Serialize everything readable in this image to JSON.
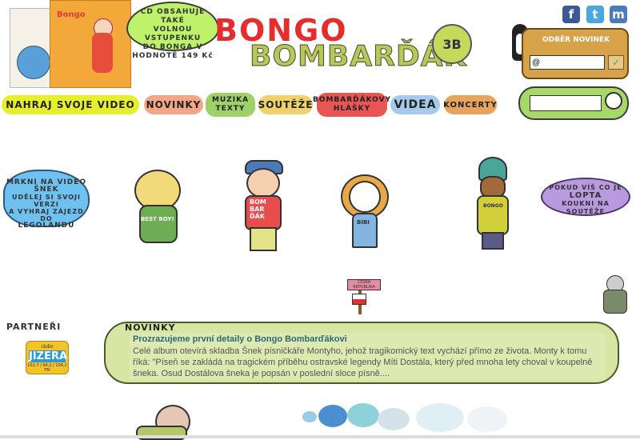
{
  "cd_promo": {
    "cover_label": "Bongo",
    "bubble_lines": [
      "CD OBSAHUJE TAKÉ",
      "VOLNOU VSTUPENKU",
      "DO BONGA V",
      "HODNOTĚ 149 Kč"
    ]
  },
  "logo": {
    "line1": "BONGO",
    "line2": "BOMBARĎÁK",
    "badge": "3B"
  },
  "social": {
    "facebook": "f",
    "twitter": "t",
    "myspace": "m"
  },
  "newsletter": {
    "title": "ODBĚR NOVINEK",
    "input_value": "@",
    "submit_icon": "check-icon"
  },
  "search": {
    "input_value": "",
    "icon": "magnifier-icon"
  },
  "nav": {
    "upload": "NAHRAJ SVOJE VIDEO",
    "news": "NOVINKY",
    "music_1": "MUZIKA",
    "music_2": "TEXTY",
    "contests": "SOUTĚŽE",
    "quotes_1": "BOMBARĎÁKOVY",
    "quotes_2": "HLÁŠKY",
    "videos": "VIDEA",
    "concerts": "KONCERTY"
  },
  "bubble_left": {
    "line1": "MRKNI NA VIDEO",
    "line2": "ŠNEK",
    "line3": "UDĚLEJ SI SVOJI VERZI",
    "line4": "A VYHRAJ ZÁJEZD DO",
    "line5": "LEGOLANDU"
  },
  "bubble_right": {
    "line1": "POKUD VÍŠ CO JE",
    "line2": "LOPTA",
    "line3": "KOUKNI NA SOUTĚŽE"
  },
  "characters": {
    "char1_shirt": "BEST BOY!",
    "char2_shirt_1": "BOM",
    "char2_shirt_2": "BAR",
    "char2_shirt_3": "ĎÁK",
    "char3_shirt": "BIBI",
    "char4_shirt": "BONGO"
  },
  "signpost": {
    "text": "ČESKÁ REPUBLIKA"
  },
  "partners": {
    "title": "PARTNEŘI",
    "logo_small": "rádio",
    "logo_name": "JIZERA",
    "logo_freq": "102,7 / 94,2 / 104,2 FM"
  },
  "news": {
    "title": "NOVINKY",
    "headline": "Prozrazujeme první detaily o Bongo Bombarďákovi",
    "body": "Celé album otevírá skladba Šnek písničkáře Montyho, jehož tragikomický text vychází přímo ze života. Monty k tomu říká: \"Píseň se zakládá na tragickém příběhu ostravské legendy Míti Dostála, který před mnoha lety choval v koupelně šneka. Osud Dostálova šneka je popsán v poslední sloce písně...."
  },
  "colors": {
    "nav_upload": "#e6f02a",
    "nav_news": "#f4a787",
    "nav_music": "#9fd169",
    "nav_contests": "#efd36a",
    "nav_quotes": "#e95454",
    "nav_videos": "#a6c9ee",
    "nav_concerts": "#e8a35d",
    "news_bg": "#d7e6a3",
    "headline": "#2a6a78"
  }
}
